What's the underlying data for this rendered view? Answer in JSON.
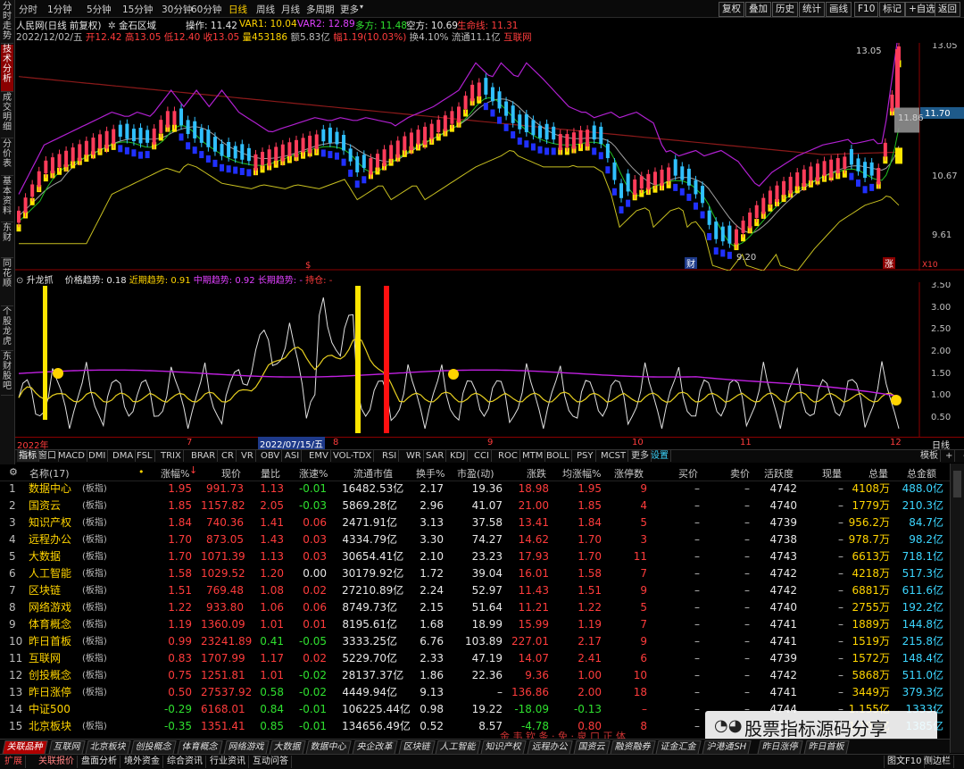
{
  "left_tabs": [
    "分时走势",
    "技术分析",
    "成交明细",
    "分价表",
    "基本资料",
    "东财",
    "同花顺",
    "个股龙虎",
    "东财股吧"
  ],
  "toolbar": {
    "periods": [
      "分时",
      "1分钟",
      "5分钟",
      "15分钟",
      "30分钟",
      "60分钟",
      "日线",
      "周线",
      "月线",
      "多周期",
      "更多"
    ],
    "selected": "日线",
    "right_buttons": [
      "复权",
      "叠加",
      "历史",
      "统计",
      "画线",
      "F10",
      "标记",
      "+自选",
      "返回"
    ]
  },
  "stock": {
    "name": "人民网(日线 前复权)",
    "extra": "金石区域",
    "op_label": "操作:",
    "op_value": "11.42",
    "var1_label": "VAR1:",
    "var1_value": "10.04",
    "var2_label": "VAR2:",
    "var2_value": "12.89",
    "duo_label": "多方:",
    "duo_value": "11.48",
    "kong_label": "空方:",
    "kong_value": "10.69",
    "life_label": "生命线:",
    "life_value": "11.31",
    "date": "2022/12/02/五",
    "open_label": "开",
    "open": "12.42",
    "high_label": "高",
    "high": "13.05",
    "low_label": "低",
    "low": "12.40",
    "close_label": "收",
    "close": "13.05",
    "vol_label": "量",
    "vol": "453186",
    "amt_label": "额",
    "amt": "5.83亿",
    "chg_label": "幅",
    "chg": "1.19(10.03%)",
    "turn_label": "换",
    "turn": "4.10%",
    "float_label": "流通",
    "float": "11.1亿",
    "sector": "互联网"
  },
  "main_chart": {
    "price_ticks": [
      "13.05",
      "11.70",
      "10.67",
      "9.61"
    ],
    "hi_label": "13.05",
    "mid_label": "11.86",
    "lo_label": "9.20",
    "scale": "X10",
    "markers": [
      "财",
      "涨",
      "$"
    ]
  },
  "sub_chart": {
    "title": "升龙抓",
    "p1_label": "价格趋势:",
    "p1": "0.18",
    "p2_label": "近期趋势:",
    "p2": "0.91",
    "p3_label": "中期趋势:",
    "p3": "0.92",
    "p4_label": "长期趋势:",
    "p4": "-",
    "p5_label": "持仓:",
    "p5": "-",
    "ticks": [
      "3.50",
      "3.00",
      "2.50",
      "2.00",
      "1.50",
      "1.00",
      "0.50"
    ]
  },
  "time_axis": {
    "labels": [
      "2022年",
      "7",
      "8",
      "9",
      "10",
      "11",
      "12"
    ],
    "cursor": "2022/07/15/五",
    "right": "日线"
  },
  "ind_tabs": [
    "指标",
    "窗口",
    "MACD",
    "DMI",
    "DMA",
    "FSL",
    "TRIX",
    "BRAR",
    "CR",
    "VR",
    "OBV",
    "ASI",
    "EMV",
    "VOL-TDX",
    "RSI",
    "WR",
    "SAR",
    "KDJ",
    "CCI",
    "ROC",
    "MTM",
    "BOLL",
    "PSY",
    "MCST",
    "更多",
    "设置"
  ],
  "ind_right": [
    "模板",
    "+",
    "-"
  ],
  "table": {
    "headers": [
      "名称(17)",
      "涨幅%",
      "现价",
      "量比",
      "涨速%",
      "流通市值",
      "换手%",
      "市盈(动)",
      "涨跌",
      "均涨幅%",
      "涨停数",
      "买价",
      "卖价",
      "活跃度",
      "现量",
      "总量",
      "总金额"
    ],
    "rows": [
      {
        "no": "1",
        "name": "数据中心",
        "tag": "(板指)",
        "chg": "1.95",
        "price": "991.73",
        "vr": "1.13",
        "spd": "-0.01",
        "mv": "16482.53亿",
        "turn": "2.17",
        "pe": "19.36",
        "diff": "18.98",
        "avg": "1.95",
        "lim": "9",
        "buy": "–",
        "sell": "–",
        "act": "4742",
        "cur": "–",
        "vol": "4108万",
        "amt": "488.0亿"
      },
      {
        "no": "2",
        "name": "国资云",
        "tag": "(板指)",
        "chg": "1.85",
        "price": "1157.82",
        "vr": "2.05",
        "spd": "-0.03",
        "mv": "5869.28亿",
        "turn": "2.96",
        "pe": "41.07",
        "diff": "21.00",
        "avg": "1.85",
        "lim": "4",
        "buy": "–",
        "sell": "–",
        "act": "4740",
        "cur": "–",
        "vol": "1779万",
        "amt": "210.3亿"
      },
      {
        "no": "3",
        "name": "知识产权",
        "tag": "(板指)",
        "chg": "1.84",
        "price": "740.36",
        "vr": "1.41",
        "spd": "0.06",
        "mv": "2471.91亿",
        "turn": "3.13",
        "pe": "37.58",
        "diff": "13.41",
        "avg": "1.84",
        "lim": "5",
        "buy": "–",
        "sell": "–",
        "act": "4739",
        "cur": "–",
        "vol": "956.2万",
        "amt": "84.7亿"
      },
      {
        "no": "4",
        "name": "远程办公",
        "tag": "(板指)",
        "chg": "1.70",
        "price": "873.05",
        "vr": "1.43",
        "spd": "0.03",
        "mv": "4334.79亿",
        "turn": "3.30",
        "pe": "74.27",
        "diff": "14.62",
        "avg": "1.70",
        "lim": "3",
        "buy": "–",
        "sell": "–",
        "act": "4738",
        "cur": "–",
        "vol": "978.7万",
        "amt": "98.2亿"
      },
      {
        "no": "5",
        "name": "大数据",
        "tag": "(板指)",
        "chg": "1.70",
        "price": "1071.39",
        "vr": "1.13",
        "spd": "0.03",
        "mv": "30654.41亿",
        "turn": "2.10",
        "pe": "23.23",
        "diff": "17.93",
        "avg": "1.70",
        "lim": "11",
        "buy": "–",
        "sell": "–",
        "act": "4743",
        "cur": "–",
        "vol": "6613万",
        "amt": "718.1亿"
      },
      {
        "no": "6",
        "name": "人工智能",
        "tag": "(板指)",
        "chg": "1.58",
        "price": "1029.52",
        "vr": "1.20",
        "spd": "0.00",
        "mv": "30179.92亿",
        "turn": "1.72",
        "pe": "39.04",
        "diff": "16.01",
        "avg": "1.58",
        "lim": "7",
        "buy": "–",
        "sell": "–",
        "act": "4742",
        "cur": "–",
        "vol": "4218万",
        "amt": "517.3亿"
      },
      {
        "no": "7",
        "name": "区块链",
        "tag": "(板指)",
        "chg": "1.51",
        "price": "769.48",
        "vr": "1.08",
        "spd": "0.02",
        "mv": "27210.89亿",
        "turn": "2.24",
        "pe": "52.97",
        "diff": "11.43",
        "avg": "1.51",
        "lim": "9",
        "buy": "–",
        "sell": "–",
        "act": "4742",
        "cur": "–",
        "vol": "6881万",
        "amt": "611.6亿"
      },
      {
        "no": "8",
        "name": "网络游戏",
        "tag": "(板指)",
        "chg": "1.22",
        "price": "933.80",
        "vr": "1.06",
        "spd": "0.06",
        "mv": "8749.73亿",
        "turn": "2.15",
        "pe": "51.64",
        "diff": "11.21",
        "avg": "1.22",
        "lim": "5",
        "buy": "–",
        "sell": "–",
        "act": "4740",
        "cur": "–",
        "vol": "2755万",
        "amt": "192.2亿"
      },
      {
        "no": "9",
        "name": "体育概念",
        "tag": "(板指)",
        "chg": "1.19",
        "price": "1360.09",
        "vr": "1.01",
        "spd": "0.01",
        "mv": "8195.61亿",
        "turn": "1.68",
        "pe": "18.99",
        "diff": "15.99",
        "avg": "1.19",
        "lim": "7",
        "buy": "–",
        "sell": "–",
        "act": "4741",
        "cur": "–",
        "vol": "1889万",
        "amt": "144.8亿"
      },
      {
        "no": "10",
        "name": "昨日首板",
        "tag": "(板指)",
        "chg": "0.99",
        "price": "23241.89",
        "vr": "0.41",
        "spd": "-0.05",
        "mv": "3333.25亿",
        "turn": "6.76",
        "pe": "103.89",
        "diff": "227.01",
        "avg": "2.17",
        "lim": "9",
        "buy": "–",
        "sell": "–",
        "act": "4741",
        "cur": "–",
        "vol": "1519万",
        "amt": "215.8亿"
      },
      {
        "no": "11",
        "name": "互联网",
        "tag": "(板指)",
        "chg": "0.83",
        "price": "1707.99",
        "vr": "1.17",
        "spd": "0.02",
        "mv": "5229.70亿",
        "turn": "2.33",
        "pe": "47.19",
        "diff": "14.07",
        "avg": "2.41",
        "lim": "6",
        "buy": "–",
        "sell": "–",
        "act": "4739",
        "cur": "–",
        "vol": "1572万",
        "amt": "148.4亿"
      },
      {
        "no": "12",
        "name": "创投概念",
        "tag": "(板指)",
        "chg": "0.75",
        "price": "1251.81",
        "vr": "1.01",
        "spd": "-0.02",
        "mv": "28137.37亿",
        "turn": "1.86",
        "pe": "22.36",
        "diff": "9.36",
        "avg": "1.00",
        "lim": "10",
        "buy": "–",
        "sell": "–",
        "act": "4742",
        "cur": "–",
        "vol": "5868万",
        "amt": "511.0亿"
      },
      {
        "no": "13",
        "name": "昨日涨停",
        "tag": "(板指)",
        "chg": "0.50",
        "price": "27537.92",
        "vr": "0.58",
        "spd": "-0.02",
        "mv": "4449.94亿",
        "turn": "9.13",
        "pe": "–",
        "diff": "136.86",
        "avg": "2.00",
        "lim": "18",
        "buy": "–",
        "sell": "–",
        "act": "4741",
        "cur": "–",
        "vol": "3449万",
        "amt": "379.3亿"
      },
      {
        "no": "14",
        "name": "中证500",
        "tag": "",
        "chg": "-0.29",
        "price": "6168.01",
        "vr": "0.84",
        "spd": "-0.01",
        "mv": "106225.44亿",
        "turn": "0.98",
        "pe": "19.22",
        "diff": "-18.09",
        "avg": "-0.13",
        "lim": "–",
        "buy": "–",
        "sell": "–",
        "act": "4744",
        "cur": "–",
        "vol": "1.155亿",
        "amt": "1333亿"
      },
      {
        "no": "15",
        "name": "北京板块",
        "tag": "(板指)",
        "chg": "-0.35",
        "price": "1351.41",
        "vr": "0.85",
        "spd": "-0.01",
        "mv": "134656.49亿",
        "turn": "0.52",
        "pe": "8.57",
        "diff": "-4.78",
        "avg": "0.80",
        "lim": "8",
        "buy": "–",
        "sell": "–",
        "act": "4744",
        "cur": "–",
        "vol": "1.192亿",
        "amt": "1385亿"
      }
    ]
  },
  "bottom_tabs": [
    "关联品种",
    "互联网",
    "北京板块",
    "创投概念",
    "体育概念",
    "网络游戏",
    "大数据",
    "数据中心",
    "央企改革",
    "区块链",
    "人工智能",
    "知识产权",
    "远程办公",
    "国资云",
    "融资融券",
    "证金汇金",
    "沪港通SH",
    "昨日涨停",
    "昨日首板"
  ],
  "status_bar": [
    "扩展",
    "关联报价",
    "盘面分析",
    "境外资金",
    "综合资讯",
    "行业资讯",
    "互动问答"
  ],
  "status_right": "图文F10",
  "status_right2": "侧边栏",
  "watermark": "股票指标源码分享",
  "overlay_text": "金 韦 钦 条 · 免 · 泉 口 正 体"
}
